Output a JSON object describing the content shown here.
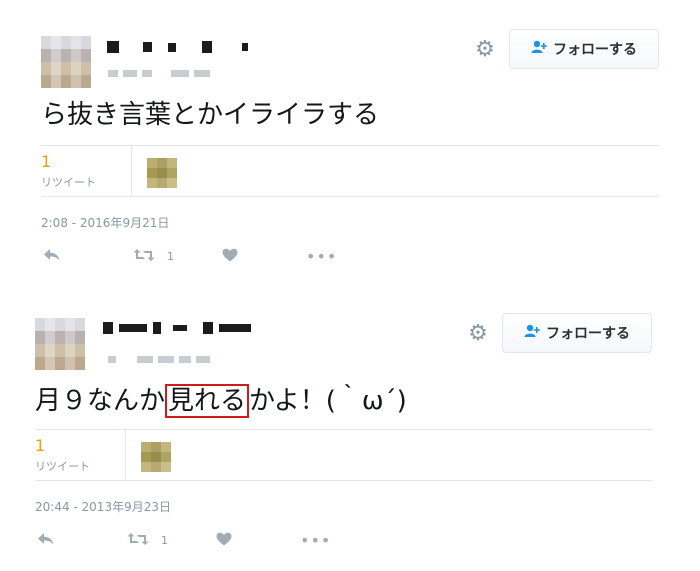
{
  "tweets": [
    {
      "follow_label": "フォローする",
      "text_before": "ら抜き言葉とかイライラする",
      "text_highlight": "",
      "text_after": "",
      "retweet_count": "1",
      "retweet_label": "リツイート",
      "timestamp": "2:08 - 2016年9月21日",
      "action_retweet_count": "1"
    },
    {
      "follow_label": "フォローする",
      "text_before": "月９なんか",
      "text_highlight": "見れる",
      "text_after": "かよ！(｀ω´)",
      "retweet_count": "1",
      "retweet_label": "リツイート",
      "timestamp": "20:44 - 2013年9月23日",
      "action_retweet_count": "1"
    }
  ],
  "icons": {
    "gear": "⚙",
    "follow": "👤+",
    "reply": "↩",
    "retweet": "⇄",
    "like": "♥",
    "more": "•••"
  },
  "colors": {
    "accent": "#1b95e0",
    "highlight_border": "#d11a1a",
    "retweet_count": "#e6a000",
    "muted": "#8899a6"
  }
}
